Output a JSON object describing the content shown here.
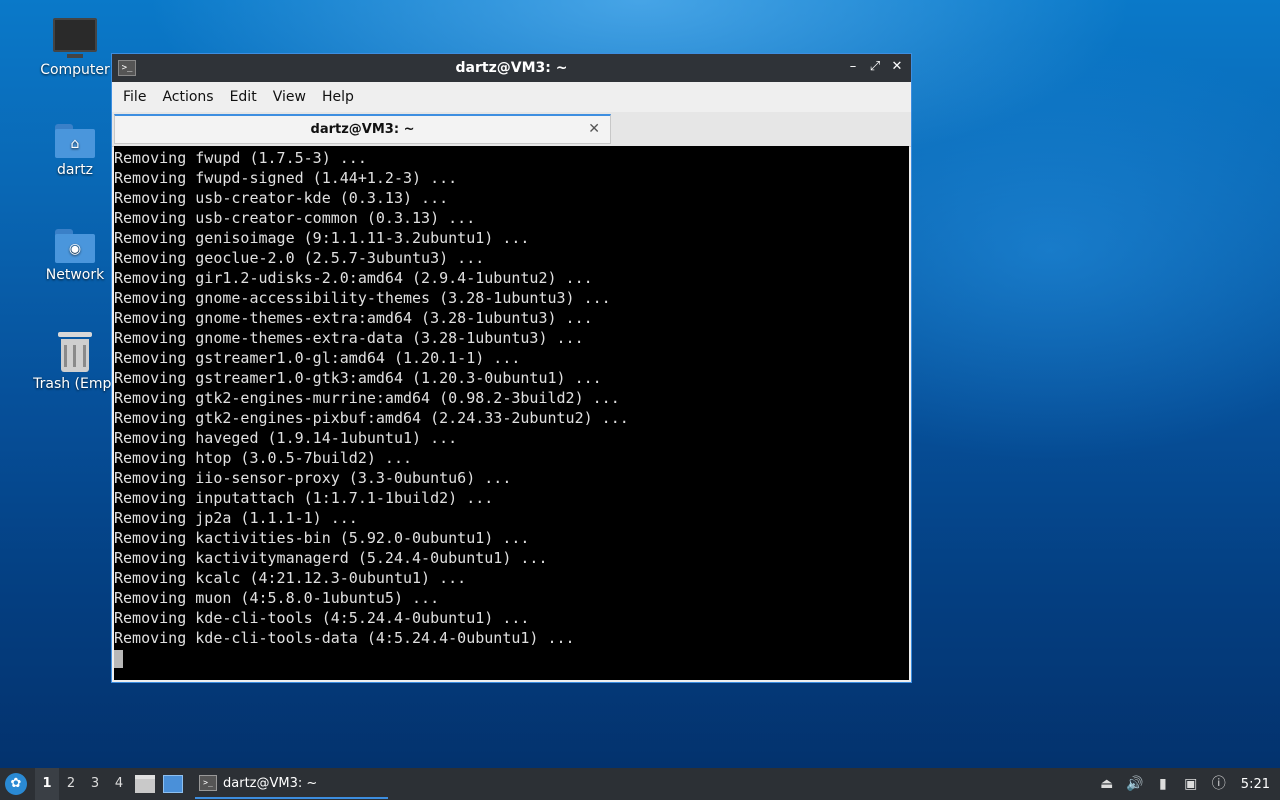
{
  "desktop": {
    "icons": [
      {
        "label": "Computer",
        "icon": "monitor-icon"
      },
      {
        "label": "dartz",
        "icon": "home-folder-icon"
      },
      {
        "label": "Network",
        "icon": "network-folder-icon"
      },
      {
        "label": "Trash (Empt",
        "icon": "trash-icon"
      }
    ]
  },
  "window": {
    "title": "dartz@VM3: ~",
    "menu": [
      "File",
      "Actions",
      "Edit",
      "View",
      "Help"
    ],
    "tab_label": "dartz@VM3: ~",
    "terminal_lines": [
      "Removing fwupd (1.7.5-3) ...",
      "Removing fwupd-signed (1.44+1.2-3) ...",
      "Removing usb-creator-kde (0.3.13) ...",
      "Removing usb-creator-common (0.3.13) ...",
      "Removing genisoimage (9:1.1.11-3.2ubuntu1) ...",
      "Removing geoclue-2.0 (2.5.7-3ubuntu3) ...",
      "Removing gir1.2-udisks-2.0:amd64 (2.9.4-1ubuntu2) ...",
      "Removing gnome-accessibility-themes (3.28-1ubuntu3) ...",
      "Removing gnome-themes-extra:amd64 (3.28-1ubuntu3) ...",
      "Removing gnome-themes-extra-data (3.28-1ubuntu3) ...",
      "Removing gstreamer1.0-gl:amd64 (1.20.1-1) ...",
      "Removing gstreamer1.0-gtk3:amd64 (1.20.3-0ubuntu1) ...",
      "Removing gtk2-engines-murrine:amd64 (0.98.2-3build2) ...",
      "Removing gtk2-engines-pixbuf:amd64 (2.24.33-2ubuntu2) ...",
      "Removing haveged (1.9.14-1ubuntu1) ...",
      "Removing htop (3.0.5-7build2) ...",
      "Removing iio-sensor-proxy (3.3-0ubuntu6) ...",
      "Removing inputattach (1:1.7.1-1build2) ...",
      "Removing jp2a (1.1.1-1) ...",
      "Removing kactivities-bin (5.92.0-0ubuntu1) ...",
      "Removing kactivitymanagerd (5.24.4-0ubuntu1) ...",
      "Removing kcalc (4:21.12.3-0ubuntu1) ...",
      "Removing muon (4:5.8.0-1ubuntu5) ...",
      "Removing kde-cli-tools (4:5.24.4-0ubuntu1) ...",
      "Removing kde-cli-tools-data (4:5.24.4-0ubuntu1) ..."
    ]
  },
  "taskbar": {
    "workspaces": [
      "1",
      "2",
      "3",
      "4"
    ],
    "active_workspace": "1",
    "task_label": "dartz@VM3: ~",
    "clock": "5:21"
  }
}
